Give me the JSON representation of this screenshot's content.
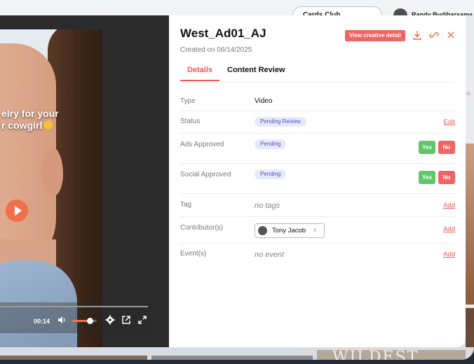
{
  "topbar": {
    "search_text": "Cards Club",
    "user_name": "Randy Budiharsama"
  },
  "video": {
    "caption_line1": "elry for your",
    "caption_line2": "r cowgirl",
    "time": "00:14",
    "volume_fraction": 0.72,
    "progress_fraction": 1.0
  },
  "panel": {
    "title": "West_Ad01_AJ",
    "created": "Created on 06/14/2025",
    "view_creative_label": "View creative detail",
    "tabs": [
      {
        "label": "Details",
        "active": true
      },
      {
        "label": "Content Review",
        "active": false
      }
    ],
    "rows": {
      "type": {
        "label": "Type",
        "value": "Video"
      },
      "status": {
        "label": "Status",
        "value": "Pending Review",
        "action": "Edit"
      },
      "ads_approved": {
        "label": "Ads Approved",
        "value": "Pending",
        "yes": "Yes",
        "no": "No"
      },
      "social_approved": {
        "label": "Social Approved",
        "value": "Pending",
        "yes": "Yes",
        "no": "No"
      },
      "tag": {
        "label": "Tag",
        "value": "no tags",
        "action": "Add"
      },
      "contributor": {
        "label": "Contributor(s)",
        "name": "Tony Jacob",
        "remove": "×",
        "action": "Add"
      },
      "event": {
        "label": "Event(s)",
        "value": "no event",
        "action": "Add"
      }
    }
  },
  "colors": {
    "accent": "#ef5a5a",
    "yes": "#5fc86a",
    "no": "#f06464",
    "pill_bg": "#e8e9fb",
    "pill_text": "#4a4fd0",
    "play": "#f26f4b"
  },
  "icons": [
    "download-icon",
    "link-icon",
    "close-icon",
    "play-icon",
    "volume-icon",
    "settings-icon",
    "popout-icon",
    "fullscreen-icon"
  ]
}
